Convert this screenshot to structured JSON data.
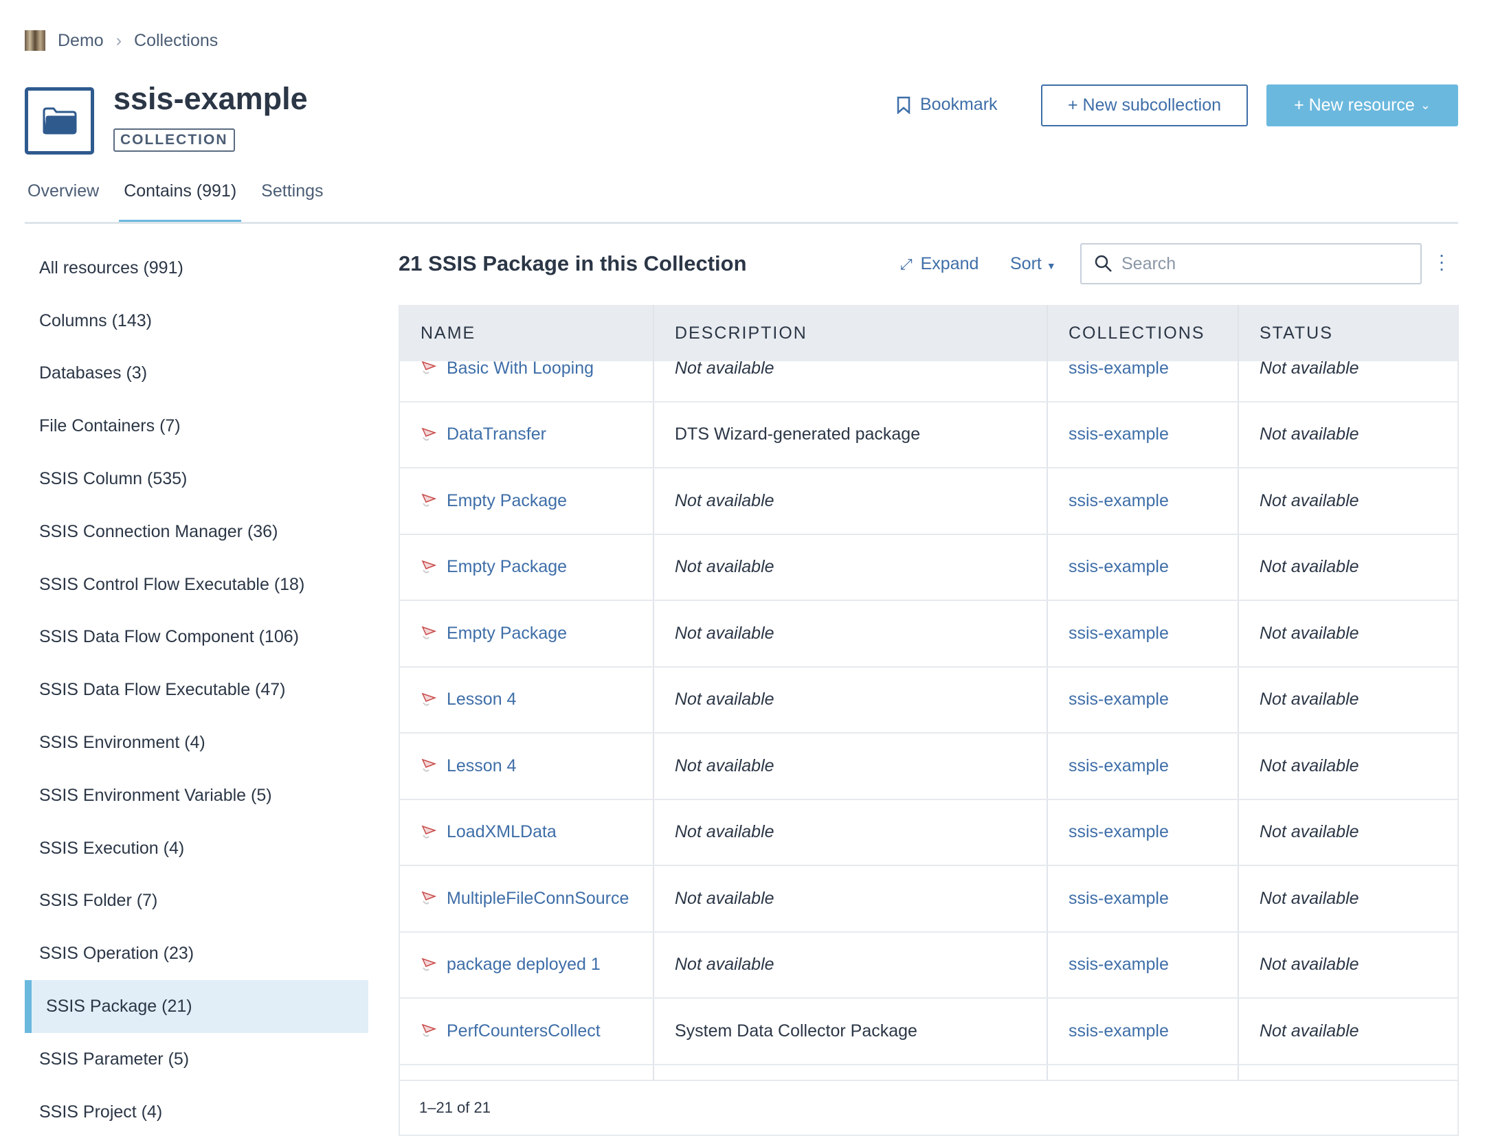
{
  "breadcrumb": [
    "Demo",
    "Collections"
  ],
  "header": {
    "title": "ssis-example",
    "badge": "COLLECTION",
    "bookmark": "Bookmark",
    "new_subcollection": "+ New subcollection",
    "new_resource": "+ New resource"
  },
  "tabs": [
    {
      "label": "Overview"
    },
    {
      "label": "Contains (991)"
    },
    {
      "label": "Settings"
    }
  ],
  "sidebar": {
    "items": [
      "All resources (991)",
      "Columns (143)",
      "Databases (3)",
      "File Containers (7)",
      "SSIS Column (535)",
      "SSIS Connection Manager (36)",
      "SSIS Control Flow Executable (18)",
      "SSIS Data Flow Component (106)",
      "SSIS Data Flow Executable (47)",
      "SSIS Environment (4)",
      "SSIS Environment Variable (5)",
      "SSIS Execution (4)",
      "SSIS Folder (7)",
      "SSIS Operation (23)",
      "SSIS Package (21)",
      "SSIS Parameter (5)",
      "SSIS Project (4)"
    ],
    "active": "SSIS Package (21)"
  },
  "main": {
    "heading": "21 SSIS Package in this Collection",
    "expand": "Expand",
    "sort": "Sort",
    "search_placeholder": "Search",
    "pagination": "1–21 of 21"
  },
  "table": {
    "columns": [
      "NAME",
      "DESCRIPTION",
      "COLLECTIONS",
      "STATUS"
    ],
    "rows": [
      [
        "Basic With Looping",
        "Not available",
        "ssis-example",
        "Not available"
      ],
      [
        "DataTransfer",
        "DTS Wizard-generated package",
        "ssis-example",
        "Not available"
      ],
      [
        "Empty Package",
        "Not available",
        "ssis-example",
        "Not available"
      ],
      [
        "Empty Package",
        "Not available",
        "ssis-example",
        "Not available"
      ],
      [
        "Empty Package",
        "Not available",
        "ssis-example",
        "Not available"
      ],
      [
        "Lesson 4",
        "Not available",
        "ssis-example",
        "Not available"
      ],
      [
        "Lesson 4",
        "Not available",
        "ssis-example",
        "Not available"
      ],
      [
        "LoadXMLData",
        "Not available",
        "ssis-example",
        "Not available"
      ],
      [
        "MultipleFileConnSource",
        "Not available",
        "ssis-example",
        "Not available"
      ],
      [
        "package deployed 1",
        "Not available",
        "ssis-example",
        "Not available"
      ],
      [
        "PerfCountersCollect",
        "System Data Collector Package",
        "ssis-example",
        "Not available"
      ]
    ]
  },
  "colors": {
    "accent": "#6bb8de",
    "link": "#3e6ea8",
    "text": "#2b3646"
  }
}
